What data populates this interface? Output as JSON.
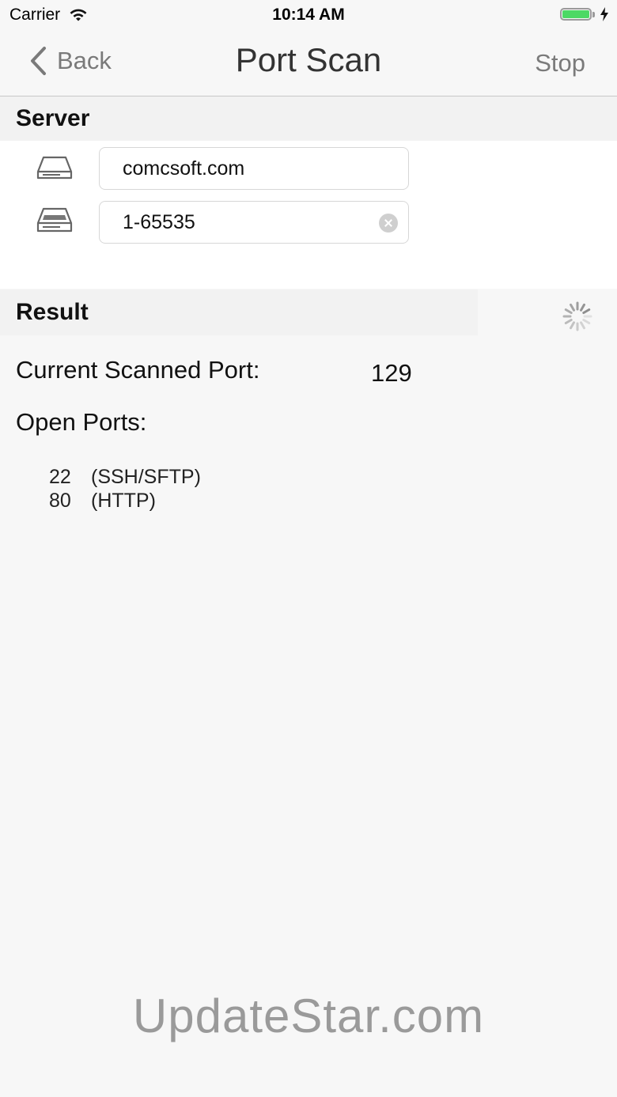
{
  "status_bar": {
    "carrier": "Carrier",
    "time": "10:14 AM",
    "battery_level": 1.0,
    "battery_color": "#4cd964"
  },
  "nav": {
    "back_label": "Back",
    "title": "Port Scan",
    "stop_label": "Stop"
  },
  "server_section": {
    "header": "Server",
    "host_icon": "hard-drive-icon",
    "host_value": "comcsoft.com",
    "range_icon": "server-range-icon",
    "range_value": "1-65535"
  },
  "result_section": {
    "header": "Result",
    "current_port_label": "Current Scanned Port:",
    "current_port_value": "129",
    "open_ports_label": "Open Ports:",
    "open_ports": [
      {
        "port": "22",
        "service": "(SSH/SFTP)"
      },
      {
        "port": "80",
        "service": "(HTTP)"
      }
    ]
  },
  "watermark": "UpdateStar.com"
}
